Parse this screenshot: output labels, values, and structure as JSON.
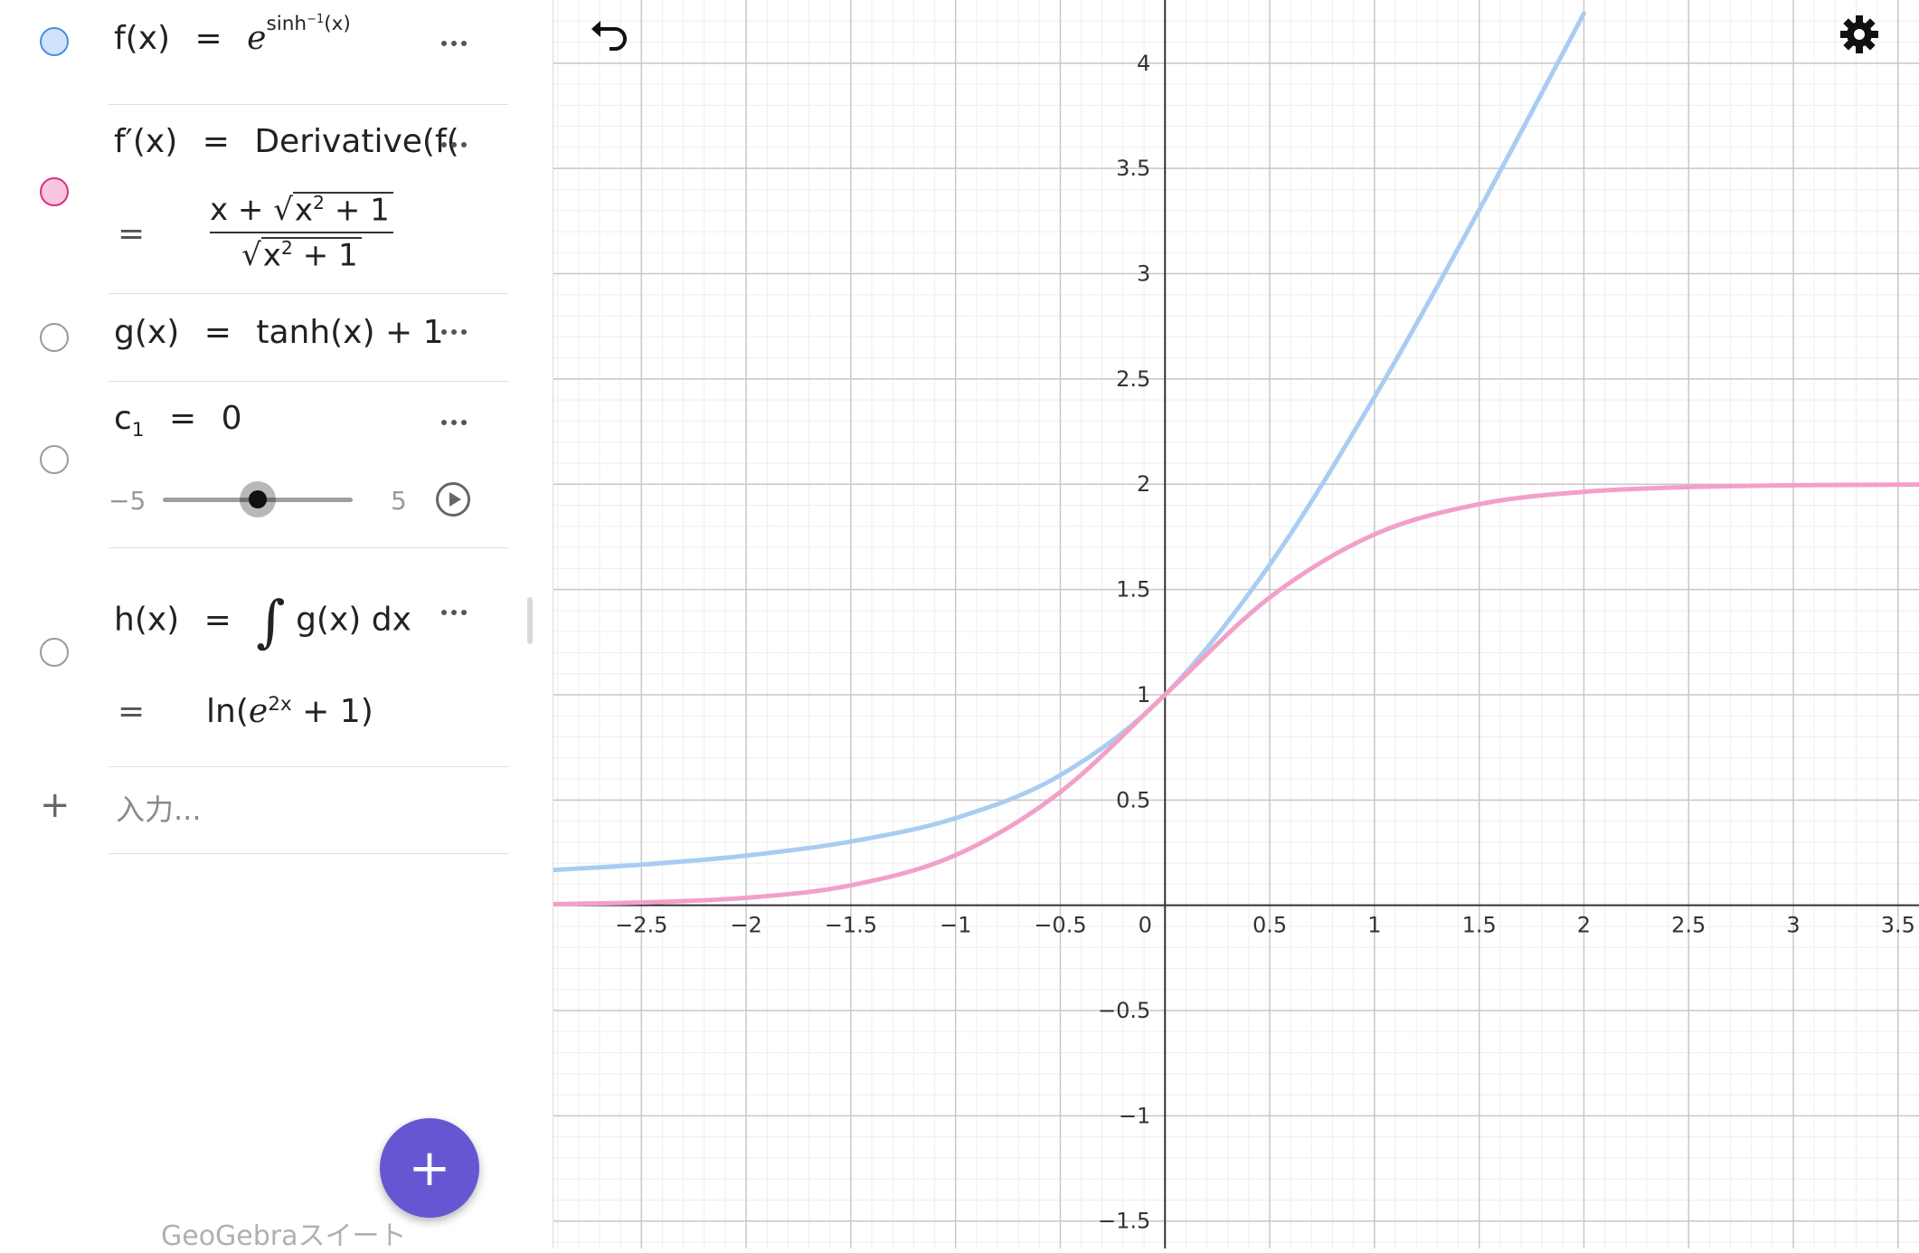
{
  "algebra": {
    "rows": [
      {
        "name": "f",
        "color": "#cfe3fa",
        "border": "#4a90d9",
        "lhs": "f(x)",
        "eq": "=",
        "base": "e",
        "sup": "sinh",
        "supsup": "−1",
        "suparg": "(x)"
      },
      {
        "name": "fprime",
        "color": "#f9c6e0",
        "border": "#d6307e",
        "lhs": "f′(x)",
        "eq": "=",
        "rhs": "Derivative(f(",
        "num_pre": "x + ",
        "rad": "x",
        "rad_sup": "2",
        "rad_post": " + 1",
        "res_eq": "="
      },
      {
        "name": "g",
        "lhs": "g(x)",
        "eq": "=",
        "rhs": "tanh(x) + 1"
      },
      {
        "name": "c1",
        "lhs": "c",
        "sub": "1",
        "eq": "=",
        "value": "0",
        "min": "−5",
        "max": "5",
        "slider_fraction": 0.5
      },
      {
        "name": "h",
        "lhs": "h(x)",
        "eq": "=",
        "integral": "∫",
        "integrand": "g(x) dx",
        "res_eq": "=",
        "res_pre": "ln",
        "res_base": "e",
        "res_sup": "2x",
        "res_post": " + 1"
      }
    ],
    "input_placeholder": "入力...",
    "plus": "+",
    "fab": "+",
    "brand": "GeoGebraスイート"
  },
  "icons": {
    "undo": "undo-icon",
    "settings": "gear-icon",
    "more": "more-dots-icon",
    "play": "play-icon"
  },
  "chart_data": {
    "type": "line",
    "x_ticks": [
      "−2.5",
      "−2",
      "−1.5",
      "−1",
      "−0.5",
      "0",
      "0.5",
      "1",
      "1.5",
      "2",
      "2.5",
      "3",
      "3.5"
    ],
    "y_ticks": [
      "−1.5",
      "−1",
      "−0.5",
      "0.5",
      "1",
      "1.5",
      "2",
      "2.5",
      "3",
      "3.5",
      "4"
    ],
    "xlim": [
      -2.92,
      3.6
    ],
    "ylim": [
      -1.63,
      4.3
    ],
    "grid": true,
    "series": [
      {
        "color": "#a9cdf2",
        "x": [
          -2.92,
          -2.5,
          -2,
          -1.5,
          -1,
          -0.5,
          0,
          0.5,
          1,
          1.5,
          2
        ],
        "y": [
          0.168,
          0.193,
          0.236,
          0.303,
          0.414,
          0.618,
          1,
          1.618,
          2.414,
          3.303,
          4.236
        ]
      },
      {
        "color": "#f2a0c9",
        "x": [
          -2.92,
          -2.5,
          -2,
          -1.5,
          -1,
          -0.5,
          0,
          0.5,
          1,
          1.5,
          2,
          2.5,
          3,
          3.6
        ],
        "y": [
          0.0058,
          0.0135,
          0.0356,
          0.0949,
          0.2384,
          0.5379,
          1,
          1.4621,
          1.7616,
          1.9051,
          1.964,
          1.9866,
          1.9951,
          1.9985
        ]
      }
    ]
  }
}
